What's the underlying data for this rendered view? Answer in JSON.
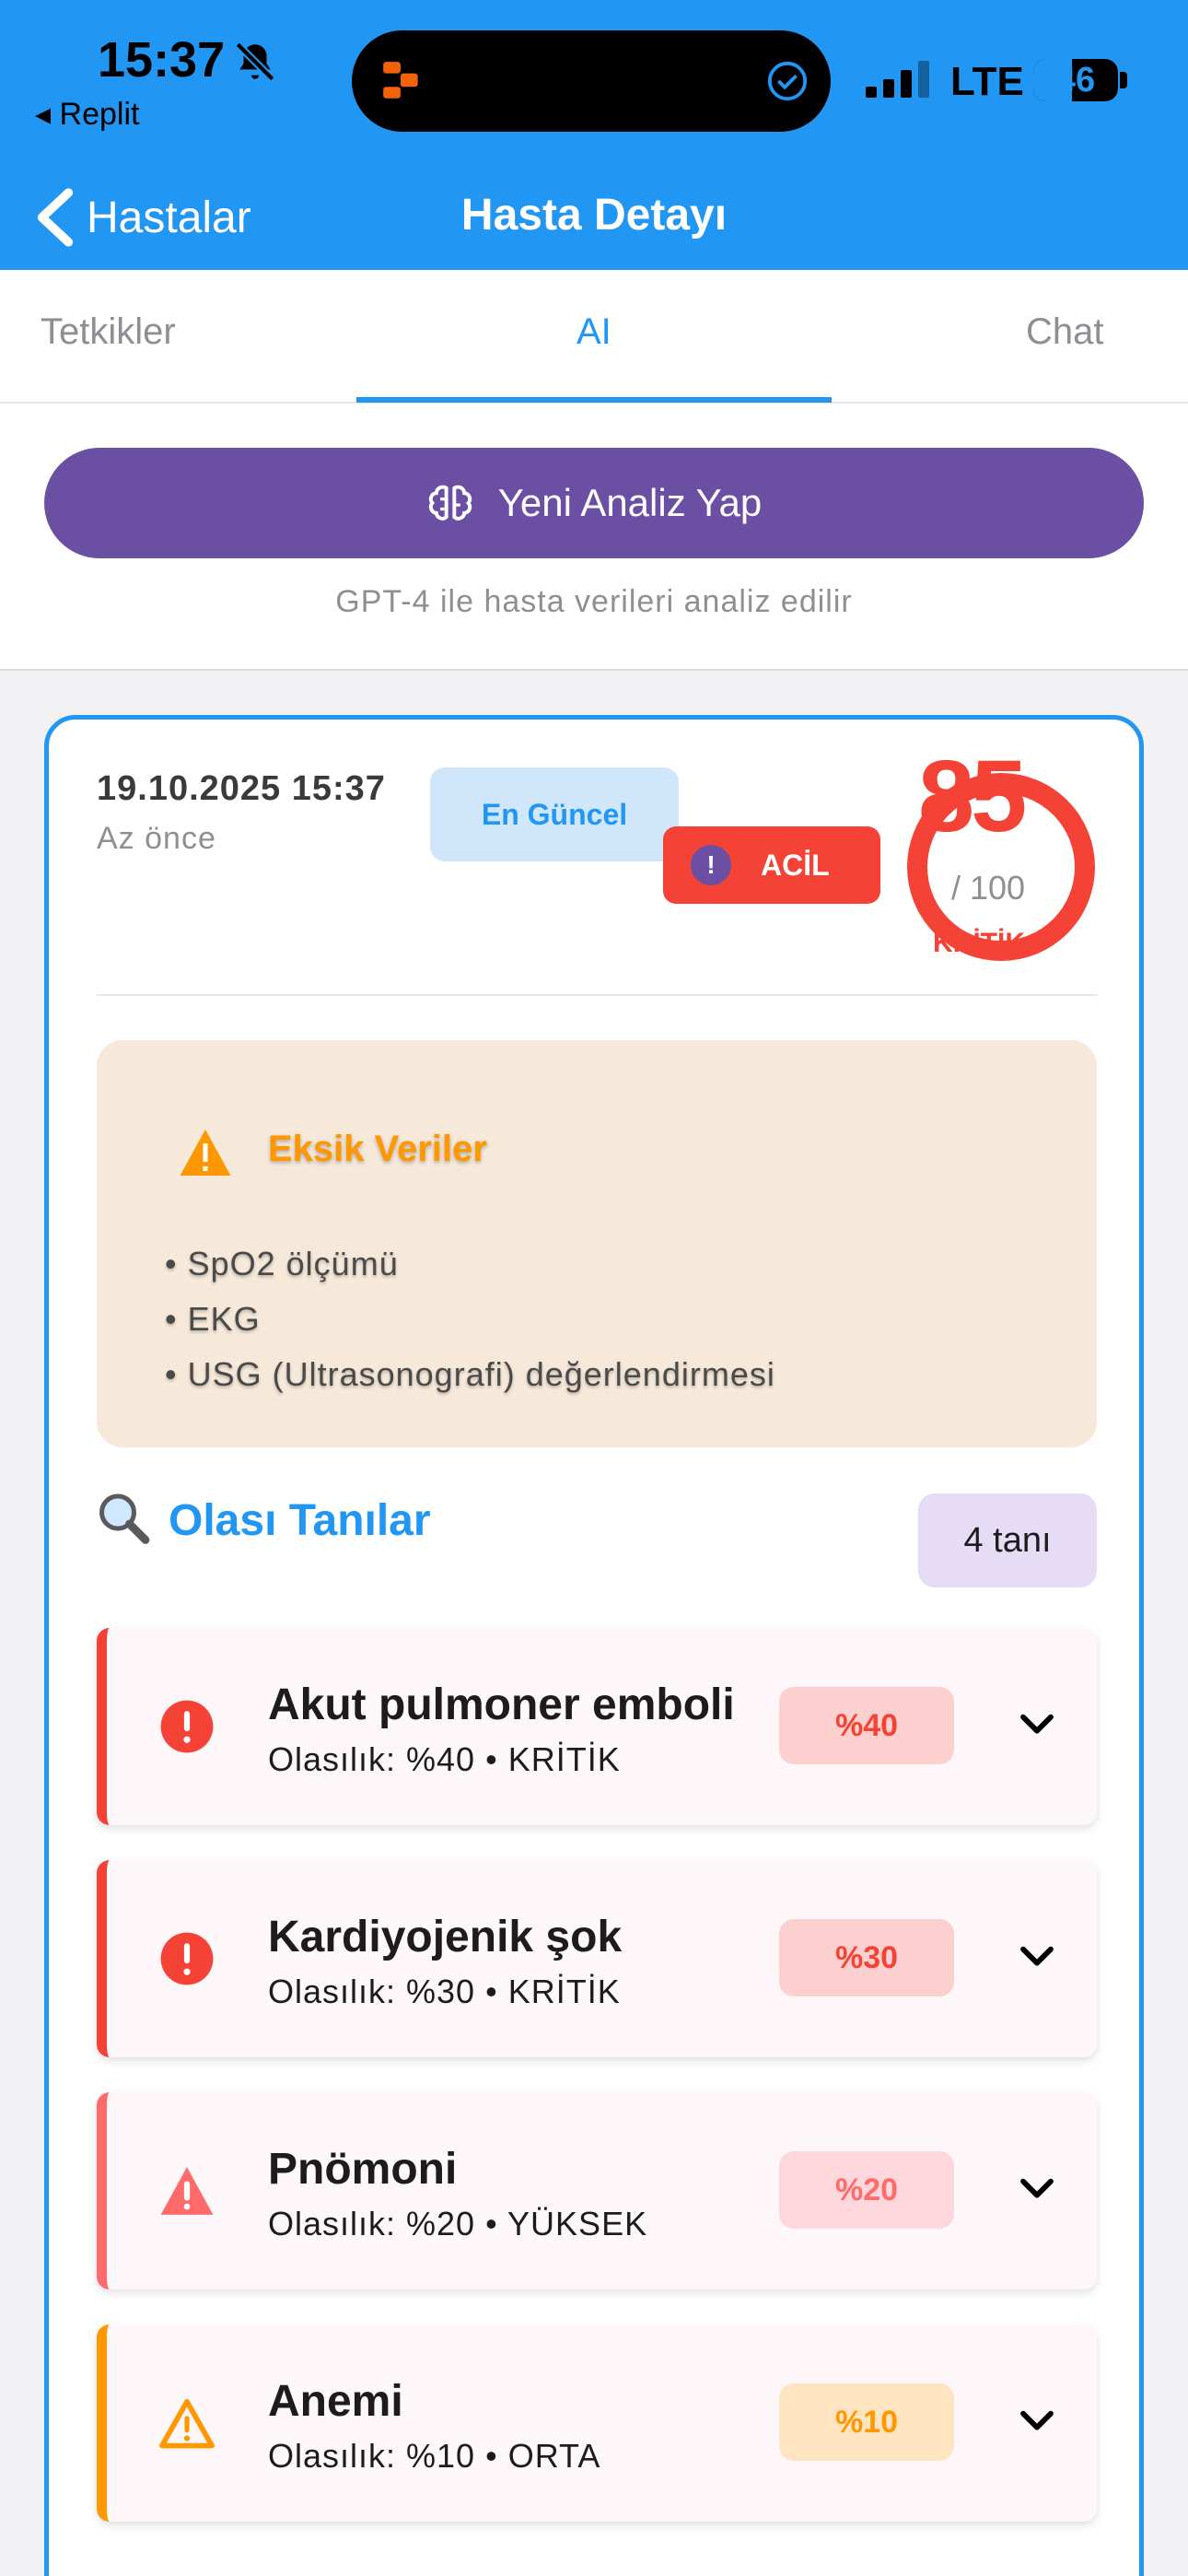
{
  "status_bar": {
    "time": "15:37",
    "back_app": "◂ Replit",
    "network": "LTE",
    "battery": "46",
    "battery_level": 0.46
  },
  "nav": {
    "back_label": "Hastalar",
    "title": "Hasta Detayı"
  },
  "tabs": [
    {
      "label": "Tetkikler",
      "active": false
    },
    {
      "label": "AI",
      "active": true
    },
    {
      "label": "Chat",
      "active": false
    }
  ],
  "analyze": {
    "button_label": "Yeni Analiz Yap",
    "note": "GPT-4 ile hasta verileri analiz edilir"
  },
  "analysis": {
    "date": "19.10.2025 15:37",
    "relative_time": "Az önce",
    "latest_badge": "En Güncel",
    "urgency_badge": "ACİL",
    "urgency_icon": "!",
    "score": "85",
    "score_max": "/ 100",
    "score_level": "KRİTİK",
    "missing": {
      "title": "Eksik Veriler",
      "items": [
        "• SpO2 ölçümü",
        "• EKG",
        "• USG (Ultrasonografi) değerlendirmesi"
      ]
    },
    "diagnoses_title": "Olası Tanılar",
    "diagnoses_count": "4 tanı",
    "diagnoses": [
      {
        "name": "Akut pulmoner emboli",
        "subtitle": "Olasılık: %40 • KRİTİK",
        "percent": "%40",
        "icon": "error-circle-icon",
        "accent": "#f44336",
        "pct_bg": "#fdd0d0",
        "pct_color": "#f44336"
      },
      {
        "name": "Kardiyojenik şok",
        "subtitle": "Olasılık: %30 • KRİTİK",
        "percent": "%30",
        "icon": "error-circle-icon",
        "accent": "#f44336",
        "pct_bg": "#fdd0d0",
        "pct_color": "#f44336"
      },
      {
        "name": "Pnömoni",
        "subtitle": "Olasılık: %20 • YÜKSEK",
        "percent": "%20",
        "icon": "warning-triangle-icon",
        "accent": "#ff6b6b",
        "pct_bg": "#fdd7dc",
        "pct_color": "#ff6b6b"
      },
      {
        "name": "Anemi",
        "subtitle": "Olasılık: %10 • ORTA",
        "percent": "%10",
        "icon": "warning-outline-icon",
        "accent": "#ff9800",
        "pct_bg": "#ffe4c2",
        "pct_color": "#ff9800"
      }
    ]
  },
  "colors": {
    "primary": "#2196f3",
    "purple": "#6a4fa3",
    "critical": "#f44336",
    "warning": "#ff9800"
  }
}
